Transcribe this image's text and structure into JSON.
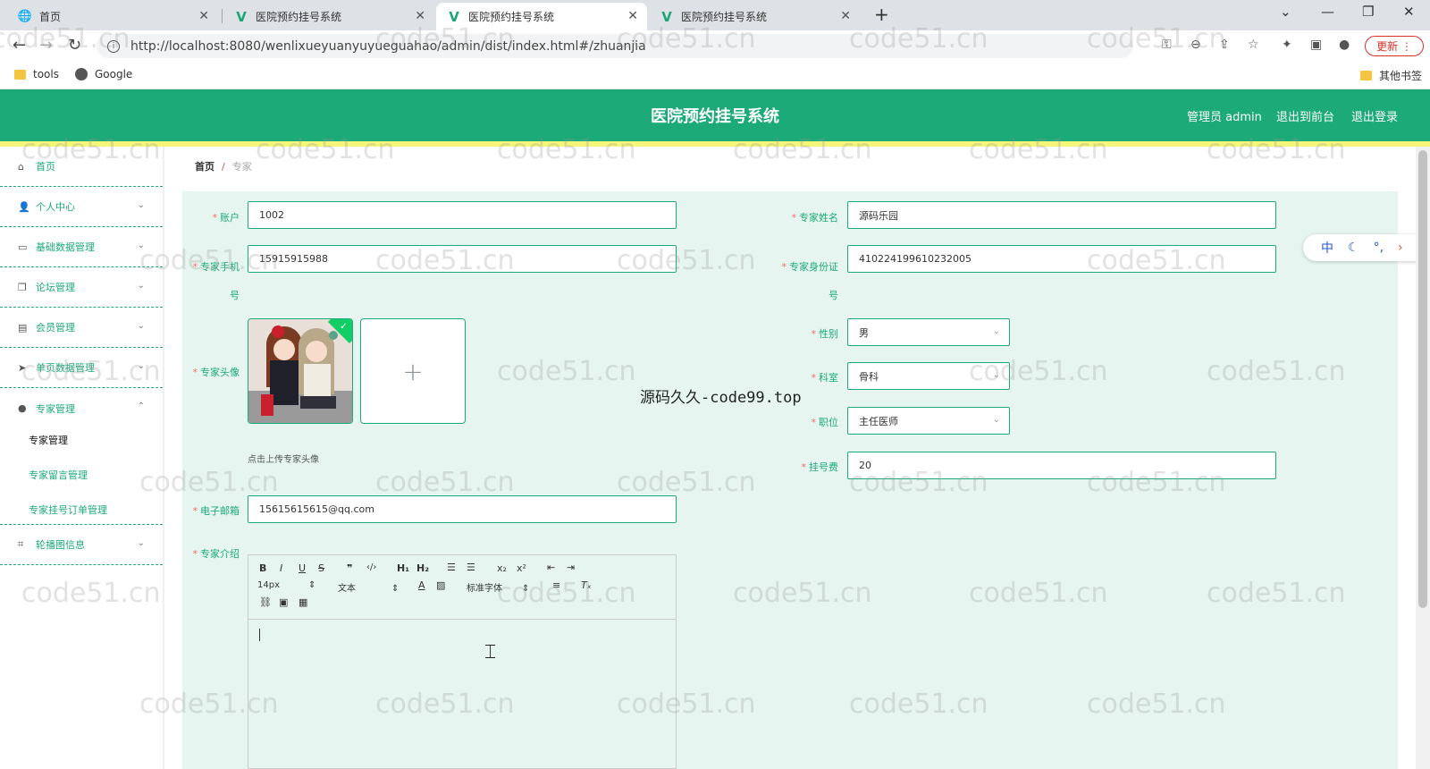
{
  "browser": {
    "tabs": [
      {
        "title": "首页",
        "icon": "globe-icon"
      },
      {
        "title": "医院预约挂号系统",
        "icon": "vue-icon"
      },
      {
        "title": "医院预约挂号系统",
        "icon": "vue-icon"
      },
      {
        "title": "医院预约挂号系统",
        "icon": "vue-icon"
      }
    ],
    "url": "http://localhost:8080/wenlixueyuanyuyueguahao/admin/dist/index.html#/zhuanjia",
    "update_label": "更新",
    "bookmarks": [
      {
        "label": "tools"
      },
      {
        "label": "Google"
      }
    ],
    "other_bookmarks": "其他书签"
  },
  "header": {
    "title": "医院预约挂号系统",
    "admin": "管理员 admin",
    "to_front": "退出到前台",
    "logout": "退出登录",
    "accent": "#1baa78"
  },
  "sidebar": {
    "items": [
      {
        "label": "首页",
        "icon": "home-icon"
      },
      {
        "label": "个人中心",
        "icon": "user-icon"
      },
      {
        "label": "基础数据管理",
        "icon": "monitor-icon"
      },
      {
        "label": "论坛管理",
        "icon": "copy-icon"
      },
      {
        "label": "会员管理",
        "icon": "briefcase-icon"
      },
      {
        "label": "单页数据管理",
        "icon": "send-icon"
      },
      {
        "label": "专家管理",
        "icon": "location-icon"
      },
      {
        "label": "轮播图信息",
        "icon": "crop-icon"
      }
    ],
    "sub": [
      "专家管理",
      "专家留言管理",
      "专家挂号订单管理"
    ]
  },
  "breadcrumb": {
    "home": "首页",
    "sep": "/",
    "current": "专家"
  },
  "form": {
    "account_label": "账户",
    "account": "1002",
    "name_label": "专家姓名",
    "name": "源码乐园",
    "phone_label": "专家手机号",
    "phone": "15915915988",
    "idcard_label": "专家身份证号",
    "idcard": "410224199610232005",
    "avatar_label": "专家头像",
    "avatar_hint": "点击上传专家头像",
    "gender_label": "性别",
    "gender": "男",
    "dept_label": "科室",
    "dept": "骨科",
    "title_label": "职位",
    "title": "主任医师",
    "fee_label": "挂号费",
    "fee": "20",
    "email_label": "电子邮箱",
    "email": "15615615615@qq.com",
    "intro_label": "专家介绍",
    "editor": {
      "font_size": "14px",
      "para": "文本",
      "font": "标准字体"
    }
  },
  "watermark": "code51.cn",
  "center_watermark": "源码久久-code99.top",
  "ime": {
    "lang": "中"
  }
}
